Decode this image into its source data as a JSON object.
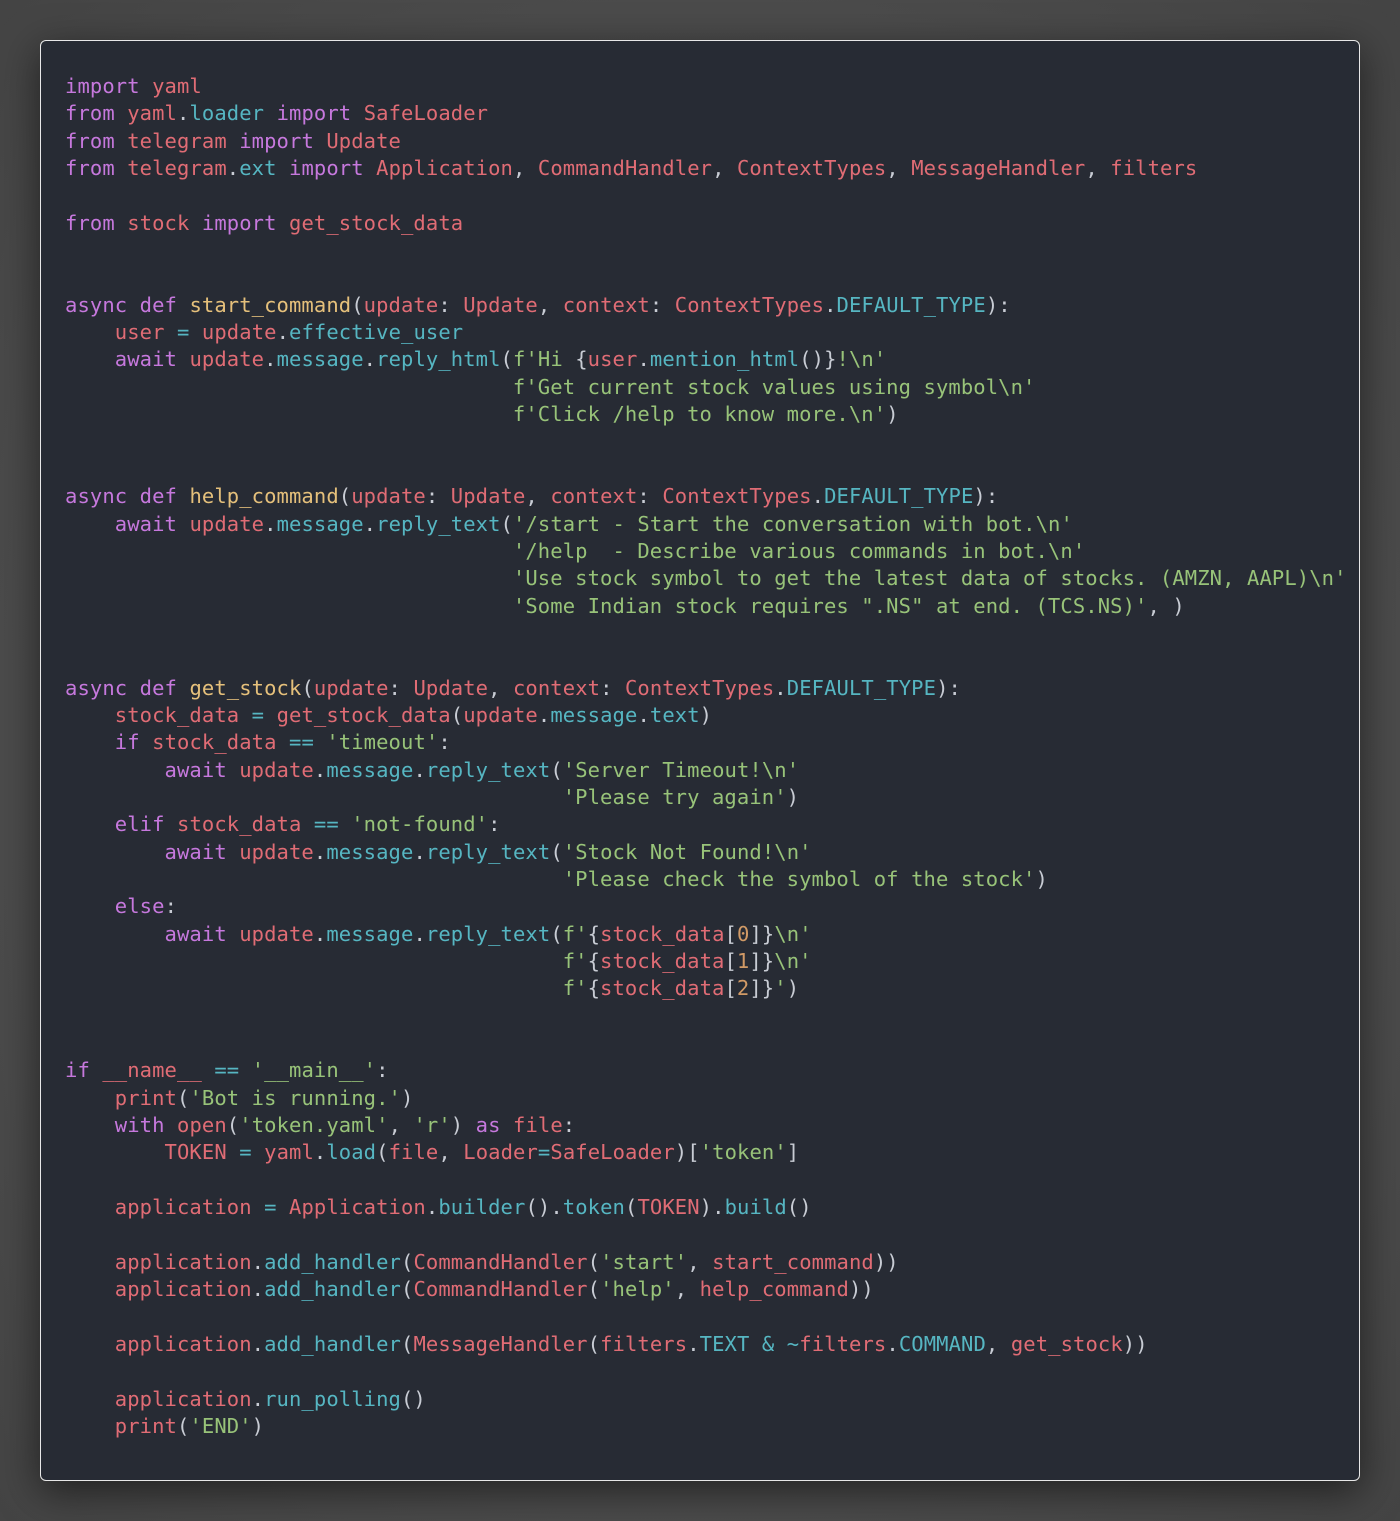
{
  "colors": {
    "page_background": "#4e4e4e",
    "editor_background": "#272b34",
    "keyword": "#c678dd",
    "name": "#e06c75",
    "function_name": "#e5c07b",
    "member": "#56b6c2",
    "string": "#98c379",
    "number": "#d19a66",
    "punctuation": "#c8ccd4"
  },
  "code": {
    "language": "python",
    "lines": [
      [
        [
          "k",
          "import"
        ],
        [
          "p",
          " "
        ],
        [
          "n",
          "yaml"
        ]
      ],
      [
        [
          "k",
          "from"
        ],
        [
          "p",
          " "
        ],
        [
          "n",
          "yaml"
        ],
        [
          "p",
          "."
        ],
        [
          "m",
          "loader"
        ],
        [
          "p",
          " "
        ],
        [
          "k",
          "import"
        ],
        [
          "p",
          " "
        ],
        [
          "n",
          "SafeLoader"
        ]
      ],
      [
        [
          "k",
          "from"
        ],
        [
          "p",
          " "
        ],
        [
          "n",
          "telegram"
        ],
        [
          "p",
          " "
        ],
        [
          "k",
          "import"
        ],
        [
          "p",
          " "
        ],
        [
          "n",
          "Update"
        ]
      ],
      [
        [
          "k",
          "from"
        ],
        [
          "p",
          " "
        ],
        [
          "n",
          "telegram"
        ],
        [
          "p",
          "."
        ],
        [
          "m",
          "ext"
        ],
        [
          "p",
          " "
        ],
        [
          "k",
          "import"
        ],
        [
          "p",
          " "
        ],
        [
          "n",
          "Application"
        ],
        [
          "p",
          ", "
        ],
        [
          "n",
          "CommandHandler"
        ],
        [
          "p",
          ", "
        ],
        [
          "n",
          "ContextTypes"
        ],
        [
          "p",
          ", "
        ],
        [
          "n",
          "MessageHandler"
        ],
        [
          "p",
          ", "
        ],
        [
          "n",
          "filters"
        ]
      ],
      [],
      [
        [
          "k",
          "from"
        ],
        [
          "p",
          " "
        ],
        [
          "n",
          "stock"
        ],
        [
          "p",
          " "
        ],
        [
          "k",
          "import"
        ],
        [
          "p",
          " "
        ],
        [
          "n",
          "get_stock_data"
        ]
      ],
      [],
      [],
      [
        [
          "k",
          "async"
        ],
        [
          "p",
          " "
        ],
        [
          "k",
          "def"
        ],
        [
          "p",
          " "
        ],
        [
          "f",
          "start_command"
        ],
        [
          "p",
          "("
        ],
        [
          "n",
          "update"
        ],
        [
          "p",
          ": "
        ],
        [
          "n",
          "Update"
        ],
        [
          "p",
          ", "
        ],
        [
          "n",
          "context"
        ],
        [
          "p",
          ": "
        ],
        [
          "n",
          "ContextTypes"
        ],
        [
          "p",
          "."
        ],
        [
          "m",
          "DEFAULT_TYPE"
        ],
        [
          "p",
          "):"
        ]
      ],
      [
        [
          "p",
          "    "
        ],
        [
          "n",
          "user"
        ],
        [
          "p",
          " "
        ],
        [
          "m",
          "="
        ],
        [
          "p",
          " "
        ],
        [
          "n",
          "update"
        ],
        [
          "p",
          "."
        ],
        [
          "m",
          "effective_user"
        ]
      ],
      [
        [
          "p",
          "    "
        ],
        [
          "k",
          "await"
        ],
        [
          "p",
          " "
        ],
        [
          "n",
          "update"
        ],
        [
          "p",
          "."
        ],
        [
          "m",
          "message"
        ],
        [
          "p",
          "."
        ],
        [
          "m",
          "reply_html"
        ],
        [
          "p",
          "("
        ],
        [
          "s",
          "f'Hi "
        ],
        [
          "p",
          "{"
        ],
        [
          "n",
          "user"
        ],
        [
          "p",
          "."
        ],
        [
          "m",
          "mention_html"
        ],
        [
          "p",
          "()}"
        ],
        [
          "s",
          "!\\n'"
        ]
      ],
      [
        [
          "p",
          "                                    "
        ],
        [
          "s",
          "f'Get current stock values using symbol\\n'"
        ]
      ],
      [
        [
          "p",
          "                                    "
        ],
        [
          "s",
          "f'Click /help to know more.\\n'"
        ],
        [
          "p",
          ")"
        ]
      ],
      [],
      [],
      [
        [
          "k",
          "async"
        ],
        [
          "p",
          " "
        ],
        [
          "k",
          "def"
        ],
        [
          "p",
          " "
        ],
        [
          "f",
          "help_command"
        ],
        [
          "p",
          "("
        ],
        [
          "n",
          "update"
        ],
        [
          "p",
          ": "
        ],
        [
          "n",
          "Update"
        ],
        [
          "p",
          ", "
        ],
        [
          "n",
          "context"
        ],
        [
          "p",
          ": "
        ],
        [
          "n",
          "ContextTypes"
        ],
        [
          "p",
          "."
        ],
        [
          "m",
          "DEFAULT_TYPE"
        ],
        [
          "p",
          "):"
        ]
      ],
      [
        [
          "p",
          "    "
        ],
        [
          "k",
          "await"
        ],
        [
          "p",
          " "
        ],
        [
          "n",
          "update"
        ],
        [
          "p",
          "."
        ],
        [
          "m",
          "message"
        ],
        [
          "p",
          "."
        ],
        [
          "m",
          "reply_text"
        ],
        [
          "p",
          "("
        ],
        [
          "s",
          "'/start - Start the conversation with bot.\\n'"
        ]
      ],
      [
        [
          "p",
          "                                    "
        ],
        [
          "s",
          "'/help  - Describe various commands in bot.\\n'"
        ]
      ],
      [
        [
          "p",
          "                                    "
        ],
        [
          "s",
          "'Use stock symbol to get the latest data of stocks. (AMZN, AAPL)\\n'"
        ]
      ],
      [
        [
          "p",
          "                                    "
        ],
        [
          "s",
          "'Some Indian stock requires \".NS\" at end. (TCS.NS)'"
        ],
        [
          "p",
          ", )"
        ]
      ],
      [],
      [],
      [
        [
          "k",
          "async"
        ],
        [
          "p",
          " "
        ],
        [
          "k",
          "def"
        ],
        [
          "p",
          " "
        ],
        [
          "f",
          "get_stock"
        ],
        [
          "p",
          "("
        ],
        [
          "n",
          "update"
        ],
        [
          "p",
          ": "
        ],
        [
          "n",
          "Update"
        ],
        [
          "p",
          ", "
        ],
        [
          "n",
          "context"
        ],
        [
          "p",
          ": "
        ],
        [
          "n",
          "ContextTypes"
        ],
        [
          "p",
          "."
        ],
        [
          "m",
          "DEFAULT_TYPE"
        ],
        [
          "p",
          "):"
        ]
      ],
      [
        [
          "p",
          "    "
        ],
        [
          "n",
          "stock_data"
        ],
        [
          "p",
          " "
        ],
        [
          "m",
          "="
        ],
        [
          "p",
          " "
        ],
        [
          "n",
          "get_stock_data"
        ],
        [
          "p",
          "("
        ],
        [
          "n",
          "update"
        ],
        [
          "p",
          "."
        ],
        [
          "m",
          "message"
        ],
        [
          "p",
          "."
        ],
        [
          "m",
          "text"
        ],
        [
          "p",
          ")"
        ]
      ],
      [
        [
          "p",
          "    "
        ],
        [
          "k",
          "if"
        ],
        [
          "p",
          " "
        ],
        [
          "n",
          "stock_data"
        ],
        [
          "p",
          " "
        ],
        [
          "m",
          "=="
        ],
        [
          "p",
          " "
        ],
        [
          "s",
          "'timeout'"
        ],
        [
          "p",
          ":"
        ]
      ],
      [
        [
          "p",
          "        "
        ],
        [
          "k",
          "await"
        ],
        [
          "p",
          " "
        ],
        [
          "n",
          "update"
        ],
        [
          "p",
          "."
        ],
        [
          "m",
          "message"
        ],
        [
          "p",
          "."
        ],
        [
          "m",
          "reply_text"
        ],
        [
          "p",
          "("
        ],
        [
          "s",
          "'Server Timeout!\\n'"
        ]
      ],
      [
        [
          "p",
          "                                        "
        ],
        [
          "s",
          "'Please try again'"
        ],
        [
          "p",
          ")"
        ]
      ],
      [
        [
          "p",
          "    "
        ],
        [
          "k",
          "elif"
        ],
        [
          "p",
          " "
        ],
        [
          "n",
          "stock_data"
        ],
        [
          "p",
          " "
        ],
        [
          "m",
          "=="
        ],
        [
          "p",
          " "
        ],
        [
          "s",
          "'not-found'"
        ],
        [
          "p",
          ":"
        ]
      ],
      [
        [
          "p",
          "        "
        ],
        [
          "k",
          "await"
        ],
        [
          "p",
          " "
        ],
        [
          "n",
          "update"
        ],
        [
          "p",
          "."
        ],
        [
          "m",
          "message"
        ],
        [
          "p",
          "."
        ],
        [
          "m",
          "reply_text"
        ],
        [
          "p",
          "("
        ],
        [
          "s",
          "'Stock Not Found!\\n'"
        ]
      ],
      [
        [
          "p",
          "                                        "
        ],
        [
          "s",
          "'Please check the symbol of the stock'"
        ],
        [
          "p",
          ")"
        ]
      ],
      [
        [
          "p",
          "    "
        ],
        [
          "k",
          "else"
        ],
        [
          "p",
          ":"
        ]
      ],
      [
        [
          "p",
          "        "
        ],
        [
          "k",
          "await"
        ],
        [
          "p",
          " "
        ],
        [
          "n",
          "update"
        ],
        [
          "p",
          "."
        ],
        [
          "m",
          "message"
        ],
        [
          "p",
          "."
        ],
        [
          "m",
          "reply_text"
        ],
        [
          "p",
          "("
        ],
        [
          "s",
          "f'"
        ],
        [
          "p",
          "{"
        ],
        [
          "n",
          "stock_data"
        ],
        [
          "p",
          "["
        ],
        [
          "d",
          "0"
        ],
        [
          "p",
          "]}"
        ],
        [
          "s",
          "\\n'"
        ]
      ],
      [
        [
          "p",
          "                                        "
        ],
        [
          "s",
          "f'"
        ],
        [
          "p",
          "{"
        ],
        [
          "n",
          "stock_data"
        ],
        [
          "p",
          "["
        ],
        [
          "d",
          "1"
        ],
        [
          "p",
          "]}"
        ],
        [
          "s",
          "\\n'"
        ]
      ],
      [
        [
          "p",
          "                                        "
        ],
        [
          "s",
          "f'"
        ],
        [
          "p",
          "{"
        ],
        [
          "n",
          "stock_data"
        ],
        [
          "p",
          "["
        ],
        [
          "d",
          "2"
        ],
        [
          "p",
          "]}"
        ],
        [
          "s",
          "'"
        ],
        [
          "p",
          ")"
        ]
      ],
      [],
      [],
      [
        [
          "k",
          "if"
        ],
        [
          "p",
          " "
        ],
        [
          "n",
          "__name__"
        ],
        [
          "p",
          " "
        ],
        [
          "m",
          "=="
        ],
        [
          "p",
          " "
        ],
        [
          "s",
          "'__main__'"
        ],
        [
          "p",
          ":"
        ]
      ],
      [
        [
          "p",
          "    "
        ],
        [
          "n",
          "print"
        ],
        [
          "p",
          "("
        ],
        [
          "s",
          "'Bot is running.'"
        ],
        [
          "p",
          ")"
        ]
      ],
      [
        [
          "p",
          "    "
        ],
        [
          "k",
          "with"
        ],
        [
          "p",
          " "
        ],
        [
          "n",
          "open"
        ],
        [
          "p",
          "("
        ],
        [
          "s",
          "'token.yaml'"
        ],
        [
          "p",
          ", "
        ],
        [
          "s",
          "'r'"
        ],
        [
          "p",
          ") "
        ],
        [
          "k",
          "as"
        ],
        [
          "p",
          " "
        ],
        [
          "n",
          "file"
        ],
        [
          "p",
          ":"
        ]
      ],
      [
        [
          "p",
          "        "
        ],
        [
          "n",
          "TOKEN"
        ],
        [
          "p",
          " "
        ],
        [
          "m",
          "="
        ],
        [
          "p",
          " "
        ],
        [
          "n",
          "yaml"
        ],
        [
          "p",
          "."
        ],
        [
          "m",
          "load"
        ],
        [
          "p",
          "("
        ],
        [
          "n",
          "file"
        ],
        [
          "p",
          ", "
        ],
        [
          "n",
          "Loader"
        ],
        [
          "m",
          "="
        ],
        [
          "n",
          "SafeLoader"
        ],
        [
          "p",
          ")["
        ],
        [
          "s",
          "'token'"
        ],
        [
          "p",
          "]"
        ]
      ],
      [],
      [
        [
          "p",
          "    "
        ],
        [
          "n",
          "application"
        ],
        [
          "p",
          " "
        ],
        [
          "m",
          "="
        ],
        [
          "p",
          " "
        ],
        [
          "n",
          "Application"
        ],
        [
          "p",
          "."
        ],
        [
          "m",
          "builder"
        ],
        [
          "p",
          "()."
        ],
        [
          "m",
          "token"
        ],
        [
          "p",
          "("
        ],
        [
          "n",
          "TOKEN"
        ],
        [
          "p",
          ")."
        ],
        [
          "m",
          "build"
        ],
        [
          "p",
          "()"
        ]
      ],
      [],
      [
        [
          "p",
          "    "
        ],
        [
          "n",
          "application"
        ],
        [
          "p",
          "."
        ],
        [
          "m",
          "add_handler"
        ],
        [
          "p",
          "("
        ],
        [
          "n",
          "CommandHandler"
        ],
        [
          "p",
          "("
        ],
        [
          "s",
          "'start'"
        ],
        [
          "p",
          ", "
        ],
        [
          "n",
          "start_command"
        ],
        [
          "p",
          "))"
        ]
      ],
      [
        [
          "p",
          "    "
        ],
        [
          "n",
          "application"
        ],
        [
          "p",
          "."
        ],
        [
          "m",
          "add_handler"
        ],
        [
          "p",
          "("
        ],
        [
          "n",
          "CommandHandler"
        ],
        [
          "p",
          "("
        ],
        [
          "s",
          "'help'"
        ],
        [
          "p",
          ", "
        ],
        [
          "n",
          "help_command"
        ],
        [
          "p",
          "))"
        ]
      ],
      [],
      [
        [
          "p",
          "    "
        ],
        [
          "n",
          "application"
        ],
        [
          "p",
          "."
        ],
        [
          "m",
          "add_handler"
        ],
        [
          "p",
          "("
        ],
        [
          "n",
          "MessageHandler"
        ],
        [
          "p",
          "("
        ],
        [
          "n",
          "filters"
        ],
        [
          "p",
          "."
        ],
        [
          "m",
          "TEXT"
        ],
        [
          "p",
          " "
        ],
        [
          "m",
          "&"
        ],
        [
          "p",
          " "
        ],
        [
          "m",
          "~"
        ],
        [
          "n",
          "filters"
        ],
        [
          "p",
          "."
        ],
        [
          "m",
          "COMMAND"
        ],
        [
          "p",
          ", "
        ],
        [
          "n",
          "get_stock"
        ],
        [
          "p",
          "))"
        ]
      ],
      [],
      [
        [
          "p",
          "    "
        ],
        [
          "n",
          "application"
        ],
        [
          "p",
          "."
        ],
        [
          "m",
          "run_polling"
        ],
        [
          "p",
          "()"
        ]
      ],
      [
        [
          "p",
          "    "
        ],
        [
          "n",
          "print"
        ],
        [
          "p",
          "("
        ],
        [
          "s",
          "'END'"
        ],
        [
          "p",
          ")"
        ]
      ]
    ]
  }
}
